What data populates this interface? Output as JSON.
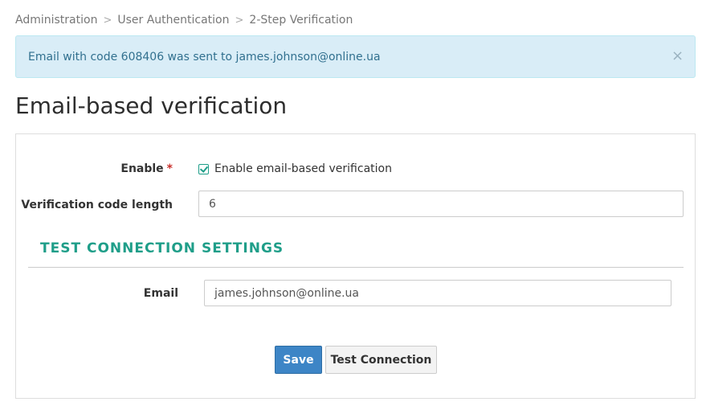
{
  "breadcrumb": {
    "items": [
      "Administration",
      "User Authentication",
      "2-Step Verification"
    ],
    "separator": ">"
  },
  "alert": {
    "message": "Email with code 608406 was sent to james.johnson@online.ua",
    "close_glyph": "×",
    "background": "#d9edf7",
    "text_color": "#31708f"
  },
  "page": {
    "title": "Email-based verification"
  },
  "form": {
    "enable": {
      "label": "Enable",
      "required_marker": "*",
      "checkbox_label": "Enable email-based verification",
      "checked": true
    },
    "code_length": {
      "label": "Verification code length",
      "value": "6"
    },
    "test_section": {
      "title": "TEST CONNECTION SETTINGS",
      "color": "#1f9e89"
    },
    "email": {
      "label": "Email",
      "value": "james.johnson@online.ua"
    }
  },
  "actions": {
    "save_label": "Save",
    "test_label": "Test Connection",
    "primary_color": "#3d85c6"
  },
  "icons": {
    "checkbox": "checkbox-checked-icon",
    "close": "close-icon",
    "separator": "chevron-right-icon"
  }
}
